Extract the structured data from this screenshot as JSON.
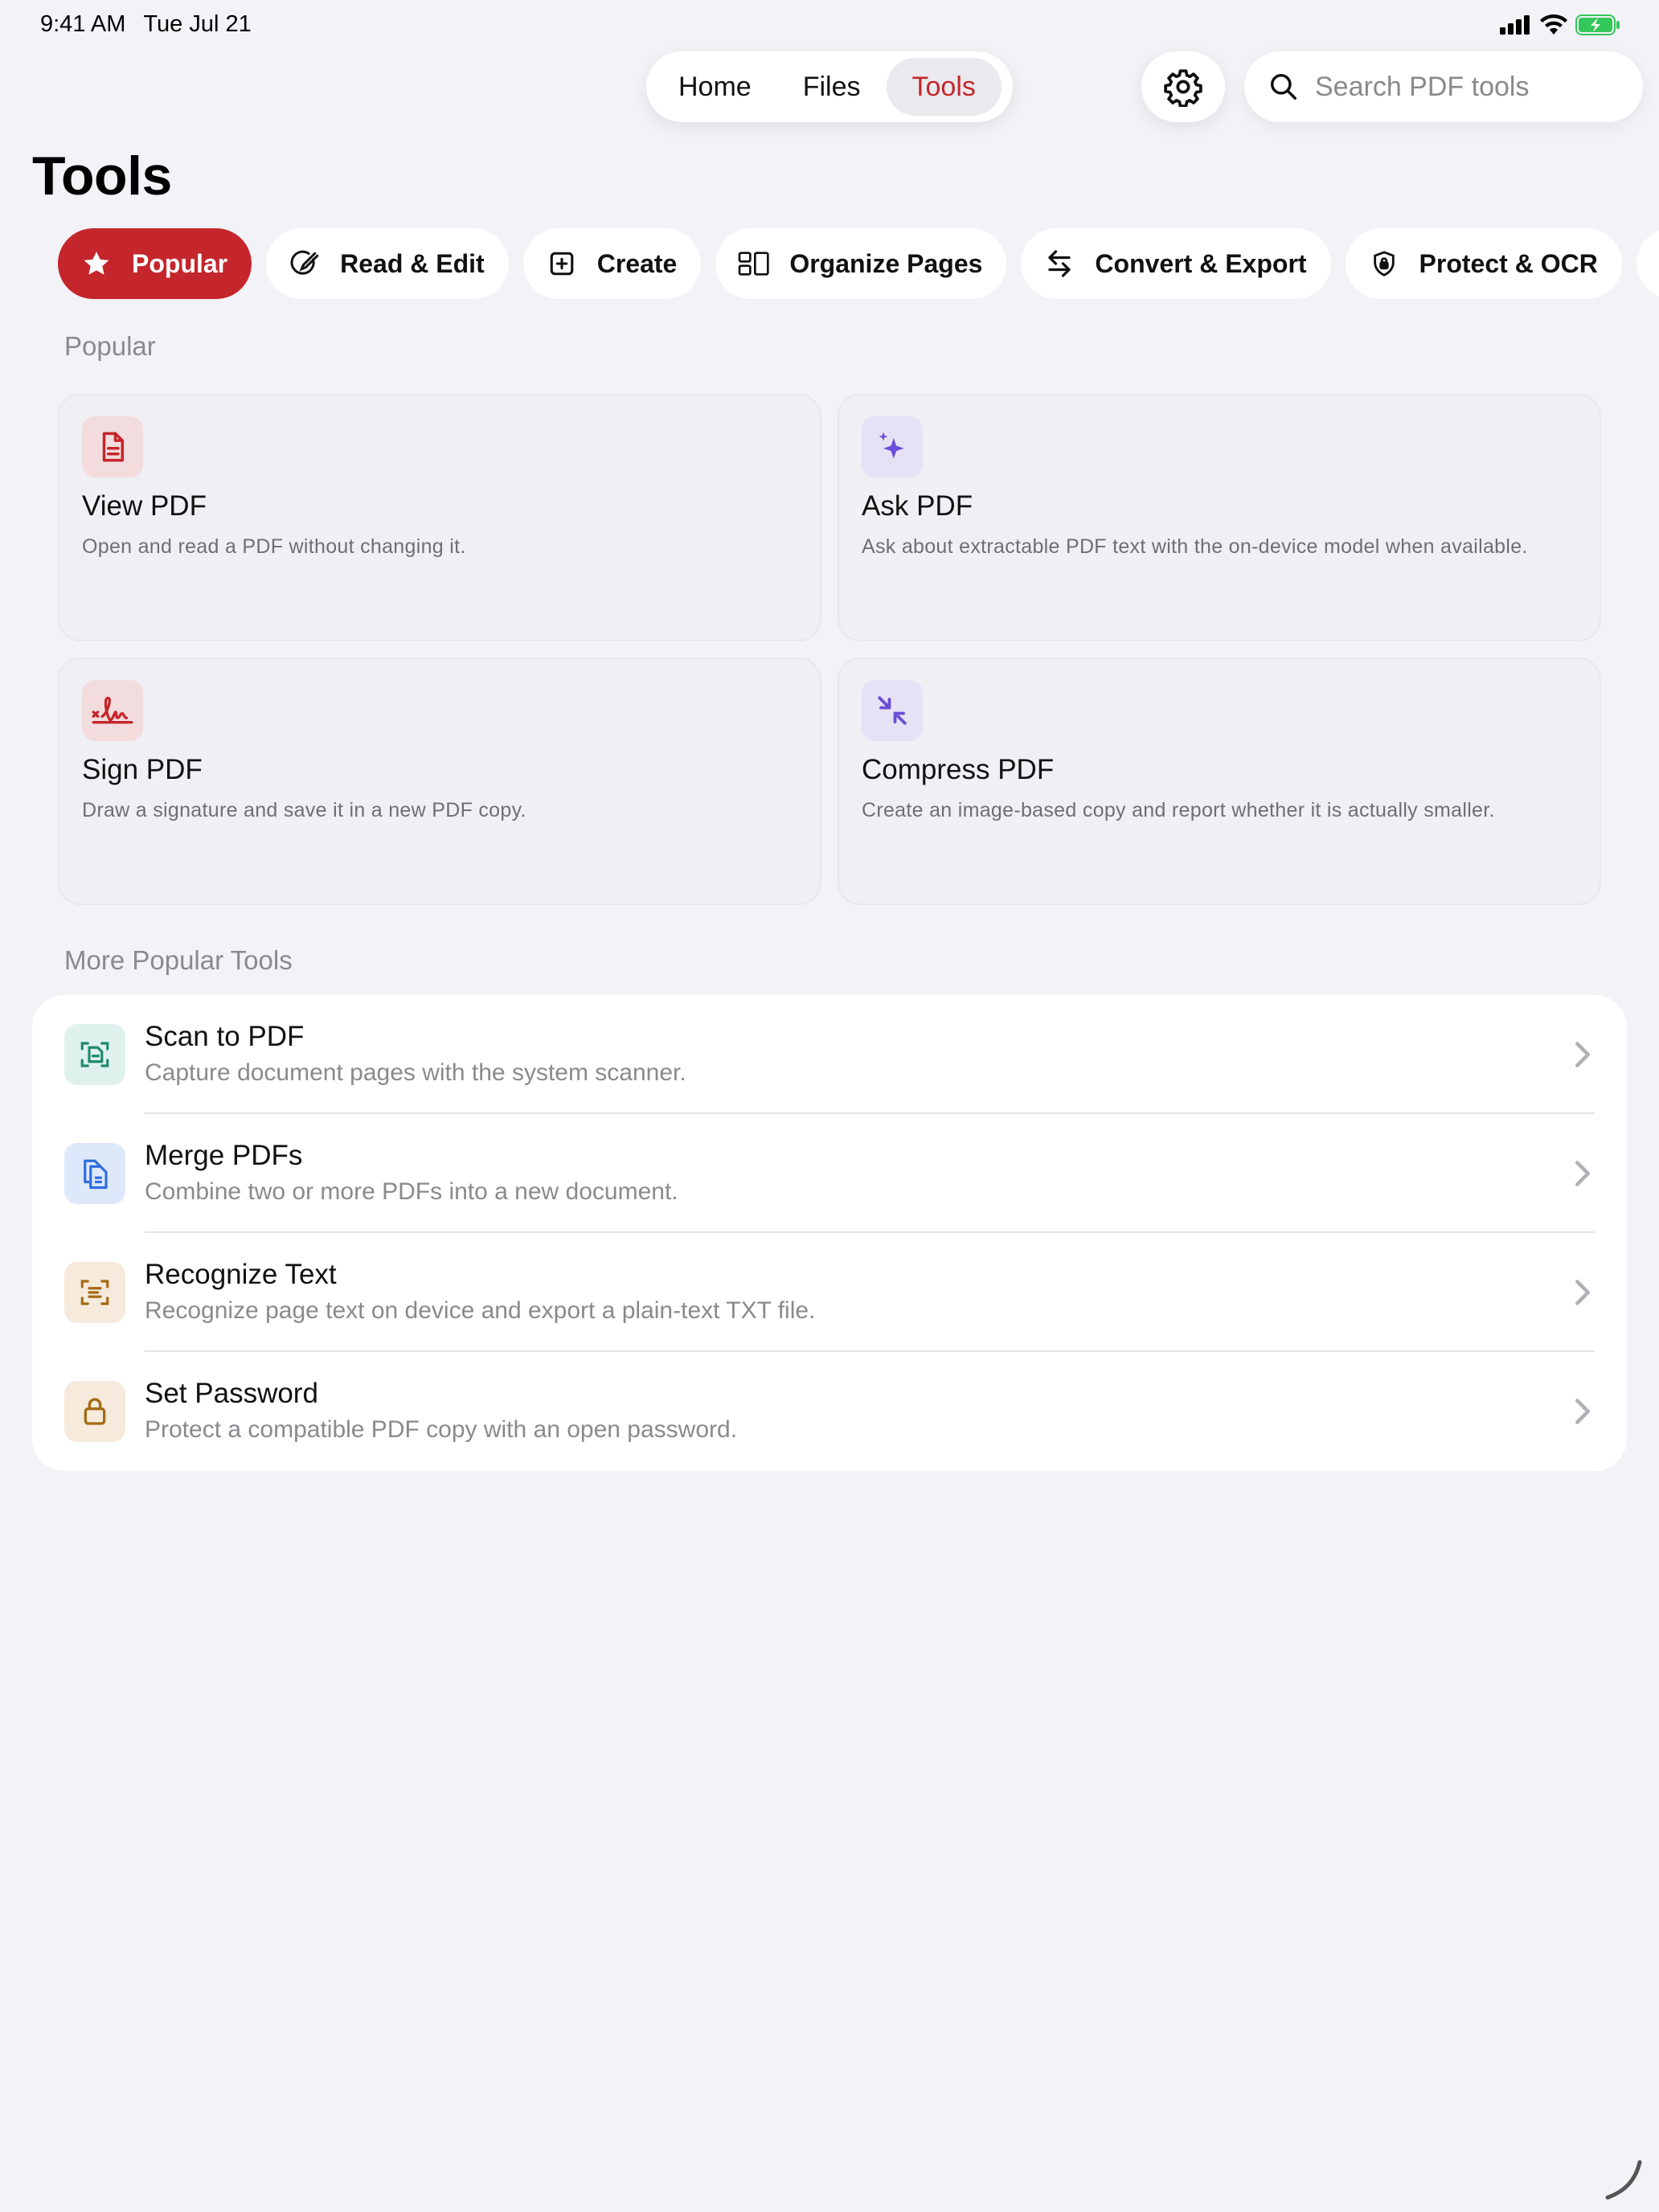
{
  "status": {
    "time": "9:41 AM",
    "date": "Tue Jul 21"
  },
  "nav": {
    "tabs": [
      "Home",
      "Files",
      "Tools"
    ],
    "active": "Tools"
  },
  "search": {
    "placeholder": "Search PDF tools"
  },
  "page_title": "Tools",
  "categories": [
    {
      "label": "Popular",
      "icon": "star-icon",
      "active": true
    },
    {
      "label": "Read & Edit",
      "icon": "pencil-circle-icon"
    },
    {
      "label": "Create",
      "icon": "plus-square-icon"
    },
    {
      "label": "Organize Pages",
      "icon": "pages-grid-icon"
    },
    {
      "label": "Convert & Export",
      "icon": "arrows-swap-icon"
    },
    {
      "label": "Protect & OCR",
      "icon": "shield-lock-icon"
    }
  ],
  "popular_section": {
    "label": "Popular"
  },
  "cards": [
    {
      "title": "View PDF",
      "desc": "Open and read a PDF without changing it.",
      "icon": "document-icon",
      "tint": "#f3dcdd",
      "color": "#c4262b"
    },
    {
      "title": "Ask PDF",
      "desc": "Ask about extractable PDF text with the on-device model when available.",
      "icon": "sparkles-icon",
      "tint": "#e6e2f5",
      "color": "#6a4fd6"
    },
    {
      "title": "Sign PDF",
      "desc": "Draw a signature and save it in a new PDF copy.",
      "icon": "signature-icon",
      "tint": "#f3dcdd",
      "color": "#c4262b"
    },
    {
      "title": "Compress PDF",
      "desc": "Create an image-based copy and report whether it is actually smaller.",
      "icon": "compress-arrows-icon",
      "tint": "#e6e2f5",
      "color": "#6a4fd6"
    }
  ],
  "more_section": {
    "label": "More Popular Tools"
  },
  "more_tools": [
    {
      "title": "Scan to PDF",
      "desc": "Capture document pages with the system scanner.",
      "icon": "doc-scanner-icon",
      "tint": "#dff1ec",
      "color": "#1e8a6c"
    },
    {
      "title": "Merge PDFs",
      "desc": "Combine two or more PDFs into a new document.",
      "icon": "documents-stack-icon",
      "tint": "#dde8fb",
      "color": "#2e6ee0"
    },
    {
      "title": "Recognize Text",
      "desc": "Recognize page text on device and export a plain-text TXT file.",
      "icon": "text-viewfinder-icon",
      "tint": "#f5eadb",
      "color": "#a46a15"
    },
    {
      "title": "Set Password",
      "desc": "Protect a compatible PDF copy with an open password.",
      "icon": "lock-icon",
      "tint": "#f5eadb",
      "color": "#a46a15"
    }
  ],
  "colors": {
    "accent": "#c4262b",
    "background": "#f2f2f7"
  }
}
